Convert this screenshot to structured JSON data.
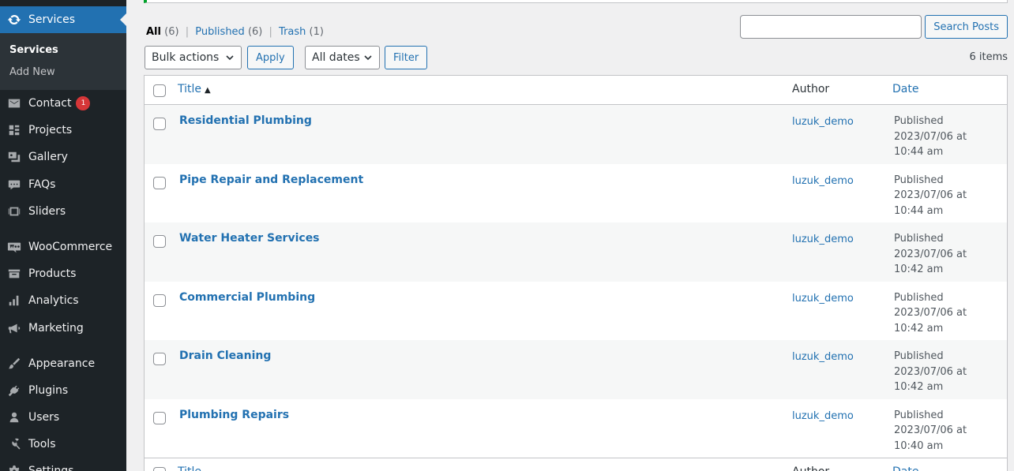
{
  "sidebar": {
    "current": {
      "label": "Services",
      "icon": "sync-icon"
    },
    "submenu": [
      {
        "label": "Services",
        "current": true
      },
      {
        "label": "Add New",
        "current": false
      }
    ],
    "items": [
      {
        "label": "Contact",
        "icon": "mail-icon",
        "badge": "1"
      },
      {
        "label": "Projects",
        "icon": "portfolio-icon"
      },
      {
        "label": "Gallery",
        "icon": "gallery-icon"
      },
      {
        "label": "FAQs",
        "icon": "comment-icon"
      },
      {
        "label": "Sliders",
        "icon": "slides-icon"
      },
      {
        "label": "WooCommerce",
        "icon": "woocommerce-icon"
      },
      {
        "label": "Products",
        "icon": "archive-icon"
      },
      {
        "label": "Analytics",
        "icon": "chart-icon"
      },
      {
        "label": "Marketing",
        "icon": "megaphone-icon"
      },
      {
        "label": "Appearance",
        "icon": "brush-icon"
      },
      {
        "label": "Plugins",
        "icon": "plugin-icon"
      },
      {
        "label": "Users",
        "icon": "user-icon"
      },
      {
        "label": "Tools",
        "icon": "wrench-icon"
      },
      {
        "label": "Settings",
        "icon": "settings-icon"
      }
    ]
  },
  "filters": {
    "all_label": "All",
    "all_count": "(6)",
    "published_label": "Published",
    "published_count": "(6)",
    "trash_label": "Trash",
    "trash_count": "(1)",
    "separator": "|"
  },
  "search": {
    "value": "",
    "button": "Search Posts"
  },
  "toolbar": {
    "bulk_actions": "Bulk actions",
    "apply": "Apply",
    "dates": "All dates",
    "filter": "Filter",
    "items_count": "6 items"
  },
  "table": {
    "columns": {
      "title": "Title",
      "author": "Author",
      "date": "Date"
    },
    "rows": [
      {
        "title": "Residential Plumbing",
        "author": "luzuk_demo",
        "status": "Published",
        "date": "2023/07/06 at 10:44 am"
      },
      {
        "title": "Pipe Repair and Replacement",
        "author": "luzuk_demo",
        "status": "Published",
        "date": "2023/07/06 at 10:44 am"
      },
      {
        "title": "Water Heater Services",
        "author": "luzuk_demo",
        "status": "Published",
        "date": "2023/07/06 at 10:42 am"
      },
      {
        "title": "Commercial Plumbing",
        "author": "luzuk_demo",
        "status": "Published",
        "date": "2023/07/06 at 10:42 am"
      },
      {
        "title": "Drain Cleaning",
        "author": "luzuk_demo",
        "status": "Published",
        "date": "2023/07/06 at 10:42 am"
      },
      {
        "title": "Plumbing Repairs",
        "author": "luzuk_demo",
        "status": "Published",
        "date": "2023/07/06 at 10:40 am"
      }
    ]
  },
  "colors": {
    "sidebar_bg": "#1d2327",
    "accent": "#2271b1",
    "badge": "#d63638",
    "notice": "#00a32a"
  }
}
